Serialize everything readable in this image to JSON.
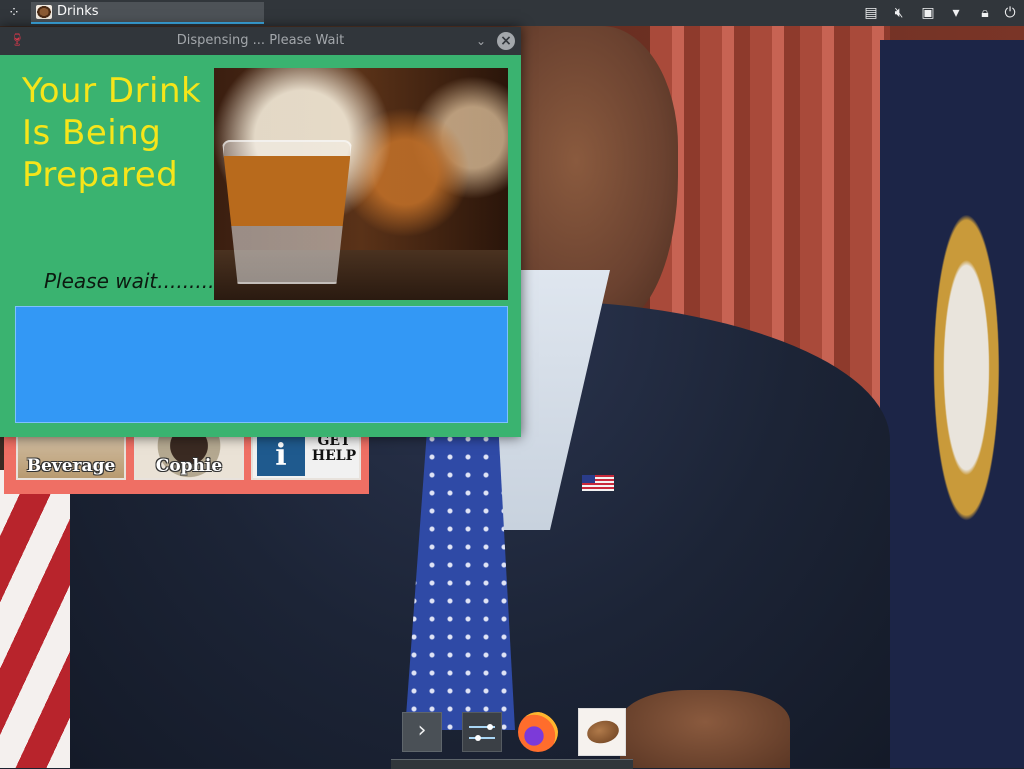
{
  "taskbar": {
    "app_launcher_icon": "plasma-launcher-icon",
    "task_label": "Drinks",
    "tray_icons": [
      "clipboard-icon",
      "volume-muted-icon",
      "network-icon",
      "expand-tray-icon",
      "lock-icon",
      "power-icon"
    ]
  },
  "dispensing_window": {
    "title": "Dispensing ... Please Wait",
    "heading": "Your Drink Is Being Prepared",
    "wait_text": "Please wait.........",
    "photo": "whiskey-shot-glass-photo",
    "colors": {
      "background": "#3ab370",
      "heading": "#f6e51a",
      "progress": "#3398f5"
    }
  },
  "background_app": {
    "tiles": [
      {
        "label": "Beverage"
      },
      {
        "label": "Cophie"
      },
      {
        "label": "GET HELP",
        "icon": "info-icon",
        "icon_text": "i"
      }
    ]
  },
  "dock": {
    "items": [
      "expand-arrow-icon",
      "settings-sliders-icon",
      "firefox-icon",
      "drinks-app-icon"
    ],
    "expand_glyph": "›"
  }
}
